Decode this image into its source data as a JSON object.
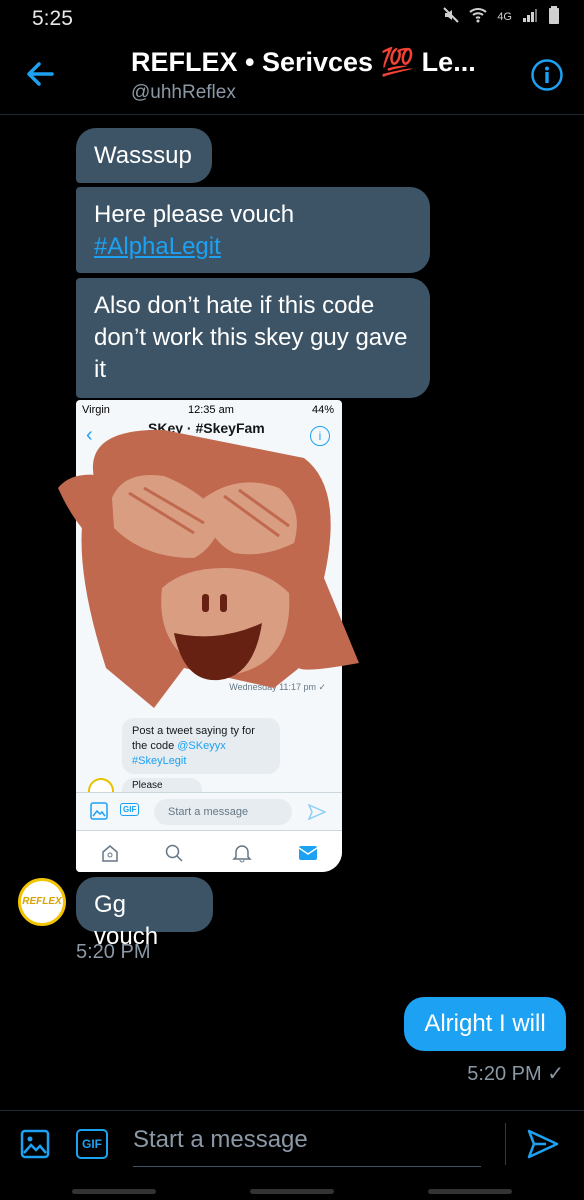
{
  "status_bar": {
    "time": "5:25",
    "network": "4G"
  },
  "header": {
    "title": "REFLEX • Serivces 💯 Le...",
    "handle": "@uhhReflex"
  },
  "messages": {
    "m1": "Wasssup",
    "m2_text": "Here please vouch",
    "m2_link": "#AlphaLegit",
    "m3": "Also don’t hate if this code don’t work this skey guy gave it",
    "m4": "Gg vouch",
    "m4_time": "5:20 PM",
    "m5": "Alright I will",
    "m5_time": "5:20 PM ✓"
  },
  "avatar": {
    "text": "REFLEX"
  },
  "screenshot": {
    "carrier": "Virgin",
    "time": "12:35 am",
    "battery": "44%",
    "title": "SKey · #SkeyFam",
    "date": "Wednesday 11:17 pm ✓",
    "bubble_text": "Post a tweet saying ty for the code",
    "bubble_mention": "@SKeyyx",
    "bubble_tag": "#SkeyLegit",
    "bubble2_text": "Please",
    "gif": "GIF",
    "placeholder": "Start a message"
  },
  "composer": {
    "gif": "GIF",
    "placeholder": "Start a message"
  },
  "colors": {
    "accent": "#1da1f2",
    "bubble": "#3d5466",
    "background": "#000000"
  }
}
